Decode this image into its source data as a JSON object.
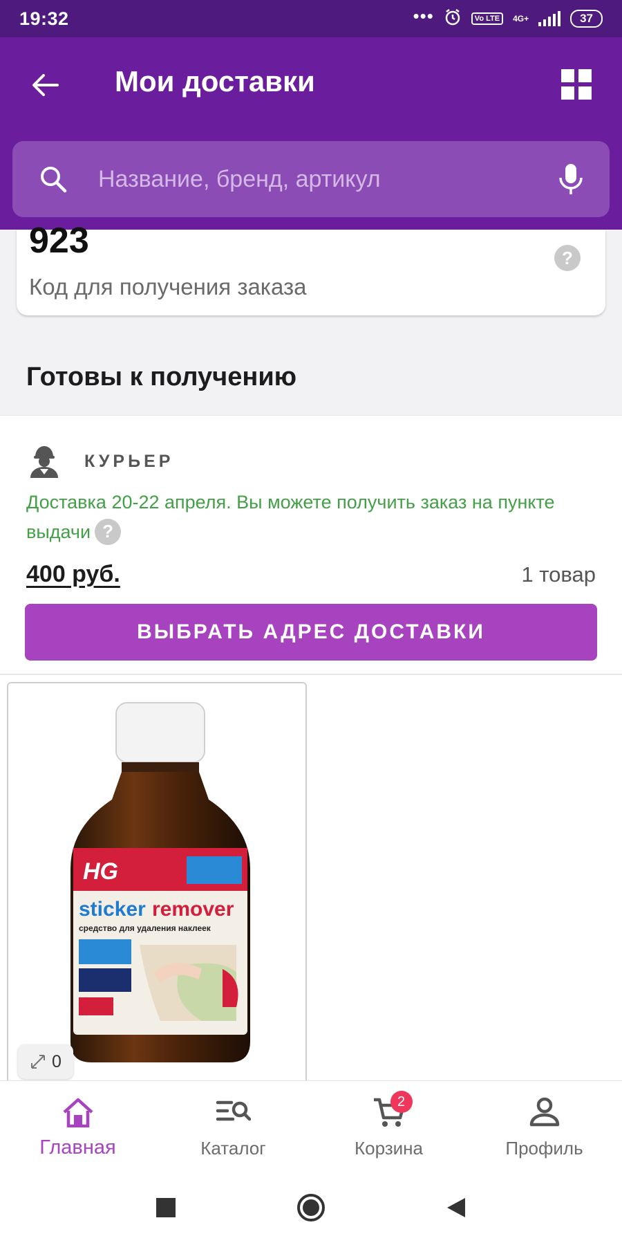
{
  "status_bar": {
    "time": "19:32",
    "network": "4G+",
    "volte": "Vo LTE",
    "battery": "37"
  },
  "header": {
    "title": "Мои доставки",
    "back_icon": "arrow-left-icon",
    "grid_icon": "grid-icon"
  },
  "search": {
    "placeholder": "Название, бренд, артикул",
    "value": ""
  },
  "code_card": {
    "code": "923",
    "label": "Код для получения заказа",
    "help": "?"
  },
  "section": {
    "title": "Готовы к получению"
  },
  "delivery": {
    "type_label": "КУРЬЕР",
    "note": "Доставка 20-22 апреля. Вы можете получить заказ на пункте выдачи",
    "help": "?",
    "price": "400 руб.",
    "items_count": "1 товар",
    "button_label": "ВЫБРАТЬ АДРЕС ДОСТАВКИ"
  },
  "product": {
    "brand": "HG",
    "name_line1": "sticker",
    "name_line2": "remover",
    "subtitle": "средство для удаления наклеек",
    "zoom_count": "0"
  },
  "bottom_nav": {
    "items": [
      {
        "label": "Главная",
        "icon": "home-icon",
        "active": true
      },
      {
        "label": "Каталог",
        "icon": "catalog-search-icon",
        "active": false
      },
      {
        "label": "Корзина",
        "icon": "cart-icon",
        "active": false,
        "badge": "2"
      },
      {
        "label": "Профиль",
        "icon": "profile-icon",
        "active": false
      }
    ]
  },
  "colors": {
    "header_bg": "#6a1d9c",
    "status_bg": "#4e1a7e",
    "accent": "#a843c0",
    "success_text": "#43a047",
    "badge": "#f0365a"
  }
}
